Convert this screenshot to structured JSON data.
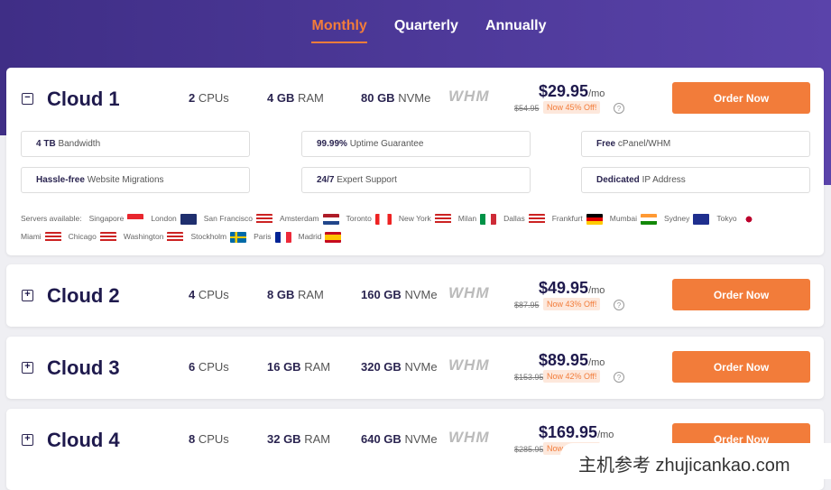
{
  "tabs": [
    {
      "label": "Monthly",
      "active": true
    },
    {
      "label": "Quarterly"
    },
    {
      "label": "Annually"
    }
  ],
  "plans": [
    {
      "name": "Cloud 1",
      "toggle": "−",
      "cpu": "2",
      "cpu_label": "CPUs",
      "ram": "4 GB",
      "ram_label": "RAM",
      "disk": "80 GB",
      "disk_label": "NVMe",
      "panel": "WHM",
      "price": "$29.95",
      "per": "/mo",
      "old": "$54.95",
      "off": "Now 45% Off!",
      "order": "Order Now"
    },
    {
      "name": "Cloud 2",
      "toggle": "+",
      "cpu": "4",
      "cpu_label": "CPUs",
      "ram": "8 GB",
      "ram_label": "RAM",
      "disk": "160 GB",
      "disk_label": "NVMe",
      "panel": "WHM",
      "price": "$49.95",
      "per": "/mo",
      "old": "$87.95",
      "off": "Now 43% Off!",
      "order": "Order Now"
    },
    {
      "name": "Cloud 3",
      "toggle": "+",
      "cpu": "6",
      "cpu_label": "CPUs",
      "ram": "16 GB",
      "ram_label": "RAM",
      "disk": "320 GB",
      "disk_label": "NVMe",
      "panel": "WHM",
      "price": "$89.95",
      "per": "/mo",
      "old": "$153.95",
      "off": "Now 42% Off!",
      "order": "Order Now"
    },
    {
      "name": "Cloud 4",
      "toggle": "+",
      "cpu": "8",
      "cpu_label": "CPUs",
      "ram": "32 GB",
      "ram_label": "RAM",
      "disk": "640 GB",
      "disk_label": "NVMe",
      "panel": "WHM",
      "price": "$169.95",
      "per": "/mo",
      "old": "$285.95",
      "off": "Now 41% Off!",
      "order": "Order Now"
    }
  ],
  "features": [
    {
      "bold": "4 TB",
      "text": " Bandwidth"
    },
    {
      "bold": "99.99%",
      "text": " Uptime Guarantee"
    },
    {
      "bold": "Free",
      "text": " cPanel/WHM"
    },
    {
      "bold": "Hassle-free",
      "text": " Website Migrations"
    },
    {
      "bold": "24/7",
      "text": " Expert Support"
    },
    {
      "bold": "Dedicated",
      "text": " IP Address"
    }
  ],
  "servers_label": "Servers available:",
  "servers": [
    {
      "city": "Singapore",
      "flag": "linear-gradient(#e8262e 50%,#fff 50%)"
    },
    {
      "city": "London",
      "flag": "#1f2f6e"
    },
    {
      "city": "San Francisco",
      "flag": "repeating-linear-gradient(#c22 0 2px,#fff 2px 4px)"
    },
    {
      "city": "Amsterdam",
      "flag": "linear-gradient(#ae1c28 33%,#fff 33% 66%,#21468b 66%)"
    },
    {
      "city": "Toronto",
      "flag": "linear-gradient(90deg,#e22 25%,#fff 25% 75%,#e22 75%)"
    },
    {
      "city": "New York",
      "flag": "repeating-linear-gradient(#c22 0 2px,#fff 2px 4px)"
    },
    {
      "city": "Milan",
      "flag": "linear-gradient(90deg,#009246 33%,#fff 33% 66%,#ce2b37 66%)"
    },
    {
      "city": "Dallas",
      "flag": "repeating-linear-gradient(#c22 0 2px,#fff 2px 4px)"
    },
    {
      "city": "Frankfurt",
      "flag": "linear-gradient(#000 33%,#d00 33% 66%,#fc0 66%)"
    },
    {
      "city": "Mumbai",
      "flag": "linear-gradient(#f93 33%,#fff 33% 66%,#138808 66%)"
    },
    {
      "city": "Sydney",
      "flag": "#1f2f8e"
    },
    {
      "city": "Tokyo",
      "flag": "radial-gradient(circle,#bc002d 30%,#fff 32%)"
    },
    {
      "city": "Miami",
      "flag": "repeating-linear-gradient(#c22 0 2px,#fff 2px 4px)"
    },
    {
      "city": "Chicago",
      "flag": "repeating-linear-gradient(#c22 0 2px,#fff 2px 4px)"
    },
    {
      "city": "Washington",
      "flag": "repeating-linear-gradient(#c22 0 2px,#fff 2px 4px)"
    },
    {
      "city": "Stockholm",
      "flag": "linear-gradient(90deg,transparent 30%,#fc0 30% 45%,transparent 45%),linear-gradient(#006aa7 40%,#fc0 40% 60%,#006aa7 60%)"
    },
    {
      "city": "Paris",
      "flag": "linear-gradient(90deg,#002395 33%,#fff 33% 66%,#ed2939 66%)"
    },
    {
      "city": "Madrid",
      "flag": "linear-gradient(#c60b1e 25%,#ffc400 25% 75%,#c60b1e 75%)"
    }
  ],
  "watermark": "主机参考 zhujicankao.com",
  "colors": {
    "accent": "#f27c3a",
    "hero_start": "#3f2e86",
    "hero_end": "#5a43aa"
  }
}
